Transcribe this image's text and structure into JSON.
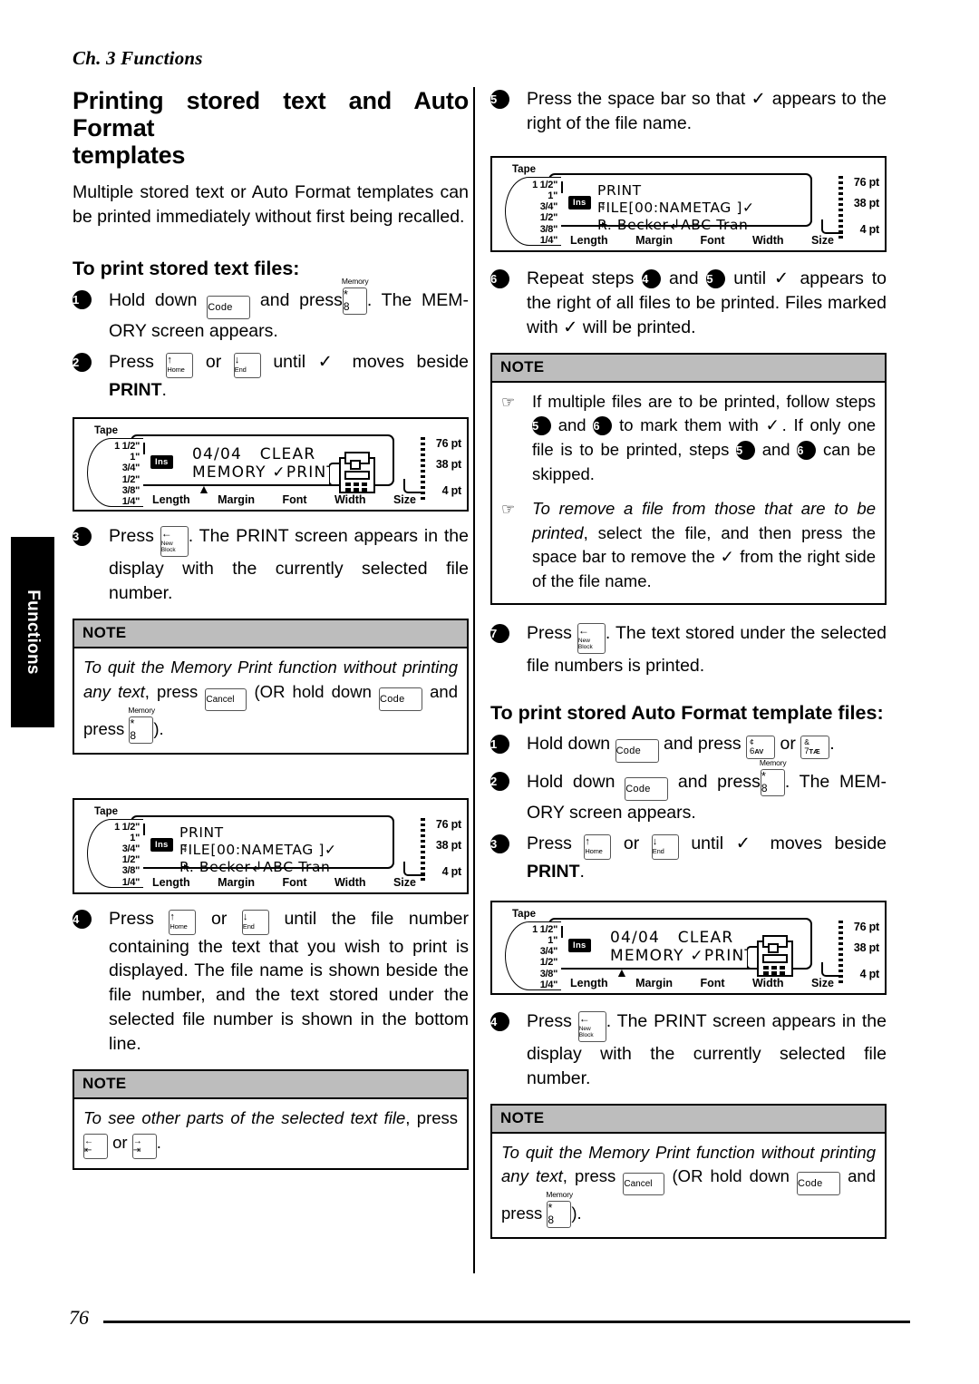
{
  "page": {
    "chapter": "Ch. 3 Functions",
    "side_tab": "Functions",
    "page_number": "76"
  },
  "left_column": {
    "title_line1": "Printing stored text and Auto Format",
    "title_line2": "templates",
    "intro": "Multiple stored text or Auto Format templates can be printed immediately without first being recalled.",
    "subheading": "To print stored text files:",
    "steps": [
      {
        "num": "1",
        "pre": "Hold down",
        "key1": "Code",
        "mid": "and press",
        "key2_top": "Memory",
        "key2_l1": "*",
        "key2_l2": "8",
        "post": ". The MEM-ORY screen appears."
      },
      {
        "num": "2",
        "pre": "Press",
        "key1_arrow": "↑",
        "key1_label": "Home",
        "mid": "or",
        "key2_arrow": "↓",
        "key2_label": "End",
        "post": "until ✓ moves beside",
        "bold_word": "PRINT",
        "tail": "."
      },
      {
        "num": "3",
        "pre": "Press",
        "key_arrow": "←",
        "key_l1": "New",
        "key_l2": "Block",
        "post": ". The PRINT screen appears in the display with the currently selected file number."
      },
      {
        "num": "4",
        "pre": "Press",
        "key1_arrow": "↑",
        "key1_label": "Home",
        "mid": "or",
        "key2_arrow": "↓",
        "key2_label": "End",
        "post": "until the file number containing the text that you wish to print is displayed. The file name is shown beside the file number, and the text stored under the selected file number is shown in the bottom line."
      }
    ],
    "note1": {
      "header": "NOTE",
      "it1": "To quit the Memory Print function without printing any text",
      "t1": ", press",
      "key_cancel": "Cancel",
      "t2": "(OR hold down",
      "key_code": "Code",
      "t3": "and press",
      "key_mem_top": "Memory",
      "key_mem_l1": "*",
      "key_mem_l2": "8",
      "t4": ")."
    },
    "note2": {
      "header": "NOTE",
      "it1": "To see other parts of the selected text file",
      "t1": ", press",
      "key1_l1": "←",
      "key1_l2": "⇤",
      "t2": "or",
      "key2_l1": "→",
      "key2_l2": "⇥",
      "t3": "."
    },
    "lcd1": {
      "tape_label": "Tape",
      "tape_scale": [
        "1 1/2\"",
        "1\"",
        "3/4\"",
        "1/2\"",
        "3/8\"",
        "1/4\""
      ],
      "ins": "Ins",
      "line1": "04/04   CLEAR",
      "line2": "MEMORY ✓PRINT",
      "caret": "▲",
      "pt": [
        "76 pt",
        "38 pt",
        "4 pt"
      ],
      "bottom": [
        "Length",
        "Margin",
        "Font",
        "Width",
        "Size"
      ]
    },
    "lcd2": {
      "tape_label": "Tape",
      "tape_scale": [
        "1 1/2\"",
        "1\"",
        "3/4\"",
        "1/2\"",
        "3/8\"",
        "1/4\""
      ],
      "ins": "Ins",
      "line1": "PRINT",
      "line2": "FILE[00:NAMETAG ]✓",
      "line3": "R. Becker↲ABC Tran",
      "updown": "↕",
      "rightmark": "▸",
      "pt": [
        "76 pt",
        "38 pt",
        "4 pt"
      ],
      "bottom": [
        "Length",
        "Margin",
        "Font",
        "Width",
        "Size"
      ]
    }
  },
  "right_column": {
    "steps": [
      {
        "num": "5",
        "text": "Press the space bar so that ✓ appears to the right of the file name."
      },
      {
        "num": "6",
        "pre": "Repeat steps",
        "ref1": "4",
        "mid": "and",
        "ref2": "5",
        "post": "until ✓ appears to the right of all files to be printed. Files marked with ✓ will be printed."
      },
      {
        "num": "7",
        "pre": "Press",
        "key_arrow": "←",
        "key_l1": "New",
        "key_l2": "Block",
        "post": ". The text stored under the selected file numbers is printed."
      }
    ],
    "note1": {
      "header": "NOTE",
      "item1_a": "If multiple files are to be printed, follow steps",
      "item1_r1": "5",
      "item1_b": "and",
      "item1_r2": "6",
      "item1_c": "to mark them with ✓. If only one file is to be printed, steps",
      "item1_r3": "5",
      "item1_d": "and",
      "item1_r4": "6",
      "item1_e": "can be skipped.",
      "item2_it": "To remove a file from those that are to be printed",
      "item2_t": ", select the file, and then press the space bar to remove the ✓ from the right side of the file name."
    },
    "subheading": "To print stored Auto Format template files:",
    "af_steps": [
      {
        "num": "1",
        "pre": "Hold down",
        "key_code": "Code",
        "mid": "and press",
        "key1_r1": "¢",
        "key1_r2": "6",
        "key1_r2b": "AV",
        "or": "or",
        "key2_r1": "&",
        "key2_r2": "7",
        "key2_r2b": "TÆ",
        "post": "."
      },
      {
        "num": "2",
        "pre": "Hold down",
        "key_code": "Code",
        "mid": "and press",
        "key_mem_top": "Memory",
        "key_mem_l1": "*",
        "key_mem_l2": "8",
        "post": ". The MEM-ORY screen appears."
      },
      {
        "num": "3",
        "pre": "Press",
        "key1_arrow": "↑",
        "key1_label": "Home",
        "mid": "or",
        "key2_arrow": "↓",
        "key2_label": "End",
        "post": "until ✓ moves beside",
        "bold_word": "PRINT",
        "tail": "."
      },
      {
        "num": "4",
        "pre": "Press",
        "key_arrow": "←",
        "key_l1": "New",
        "key_l2": "Block",
        "post": ". The PRINT screen appears in the display with the currently selected file number."
      }
    ],
    "note2": {
      "header": "NOTE",
      "it1": "To quit the Memory Print function without printing any text",
      "t1": ", press",
      "key_cancel": "Cancel",
      "t2": "(OR hold down",
      "key_code": "Code",
      "t3": "and press",
      "key_mem_top": "Memory",
      "key_mem_l1": "*",
      "key_mem_l2": "8",
      "t4": ")."
    },
    "lcd1": {
      "tape_label": "Tape",
      "tape_scale": [
        "1 1/2\"",
        "1\"",
        "3/4\"",
        "1/2\"",
        "3/8\"",
        "1/4\""
      ],
      "ins": "Ins",
      "line1": "PRINT",
      "line2": "FILE[00:NAMETAG ]✓",
      "line3": "R. Becker↲ABC Tran",
      "updown": "↕",
      "rightmark": "▸",
      "pt": [
        "76 pt",
        "38 pt",
        "4 pt"
      ],
      "bottom": [
        "Length",
        "Margin",
        "Font",
        "Width",
        "Size"
      ]
    },
    "lcd2": {
      "tape_label": "Tape",
      "tape_scale": [
        "1 1/2\"",
        "1\"",
        "3/4\"",
        "1/2\"",
        "3/8\"",
        "1/4\""
      ],
      "ins": "Ins",
      "line1": "04/04   CLEAR",
      "line2": "MEMORY ✓PRINT",
      "caret": "▲",
      "pt": [
        "76 pt",
        "38 pt",
        "4 pt"
      ],
      "bottom": [
        "Length",
        "Margin",
        "Font",
        "Width",
        "Size"
      ]
    }
  }
}
